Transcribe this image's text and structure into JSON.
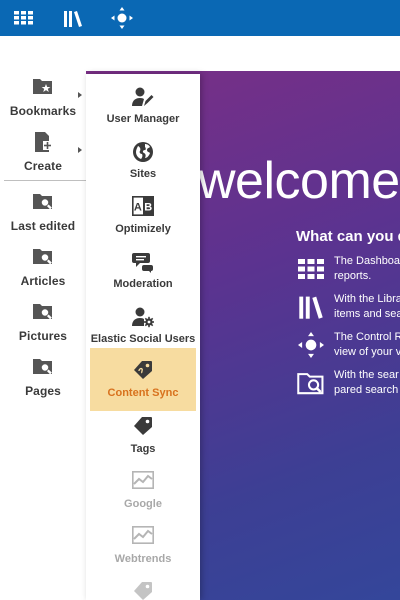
{
  "topbar": {
    "apps_icon": "grid-icon",
    "library_icon": "library-icon",
    "control_room_icon": "control-room-icon"
  },
  "sidebar": {
    "items": [
      {
        "label": "Bookmarks",
        "icon": "bookmark-folder-icon"
      },
      {
        "label": "Create",
        "icon": "new-document-icon"
      },
      {
        "label": "Last edited",
        "icon": "folder-search-icon"
      },
      {
        "label": "Articles",
        "icon": "folder-search-icon"
      },
      {
        "label": "Pictures",
        "icon": "folder-search-icon"
      },
      {
        "label": "Pages",
        "icon": "folder-search-icon"
      }
    ]
  },
  "apps_menu": {
    "items": [
      {
        "label": "User Manager",
        "icon": "user-manager-icon",
        "state": "normal"
      },
      {
        "label": "Sites",
        "icon": "globe-icon",
        "state": "normal"
      },
      {
        "label": "Optimizely",
        "icon": "ab-test-icon",
        "state": "normal"
      },
      {
        "label": "Moderation",
        "icon": "moderation-icon",
        "state": "normal"
      },
      {
        "label": "Elastic Social Users",
        "icon": "user-settings-icon",
        "state": "normal"
      },
      {
        "label": "Content Sync",
        "icon": "tag-icon",
        "state": "active"
      },
      {
        "label": "Tags",
        "icon": "tag-icon",
        "state": "normal"
      },
      {
        "label": "Google",
        "icon": "analytics-chart-icon",
        "state": "disabled"
      },
      {
        "label": "Webtrends",
        "icon": "analytics-chart-icon",
        "state": "disabled"
      }
    ]
  },
  "welcome": {
    "title": "welcome",
    "subtitle": "What can you d",
    "rows": [
      {
        "icon": "grid-icon",
        "lines": [
          "The Dashboa",
          "reports."
        ]
      },
      {
        "icon": "library-icon",
        "lines": [
          "With the Libra",
          "items and sea"
        ]
      },
      {
        "icon": "control-room-icon",
        "lines": [
          "The Control R",
          "view of your v"
        ]
      },
      {
        "icon": "folder-search-icon",
        "lines": [
          "With the sear",
          "pared search"
        ]
      }
    ]
  },
  "colors": {
    "topbar": "#0a68b4",
    "active_item_bg": "#f7dca0",
    "active_item_text": "#d8721e",
    "disabled_text": "#a8a8a8",
    "welcome_gradient_start": "#7a2f86",
    "welcome_gradient_end": "#34469a"
  }
}
